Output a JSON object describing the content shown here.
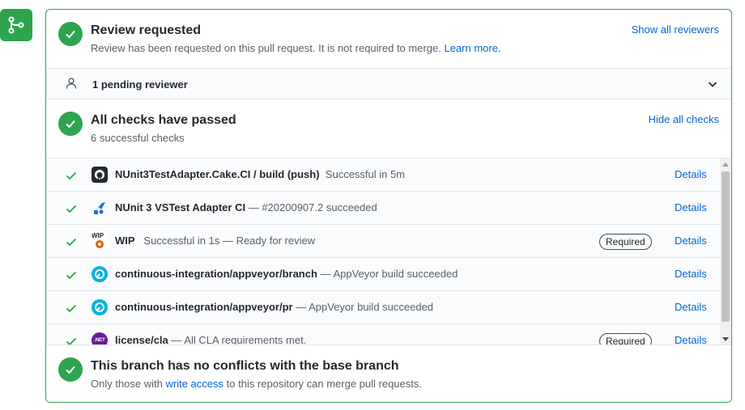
{
  "review": {
    "title": "Review requested",
    "subtitle": "Review has been requested on this pull request. It is not required to merge.",
    "learn_more": "Learn more.",
    "show_reviewers": "Show all reviewers"
  },
  "pending": {
    "label": "1 pending reviewer"
  },
  "checks": {
    "title": "All checks have passed",
    "subtitle": "6 successful checks",
    "hide_checks": "Hide all checks",
    "details_label": "Details",
    "required_label": "Required",
    "rows": [
      {
        "name": "NUnit3TestAdapter.Cake.CI / build (push)",
        "desc": "Successful in 5m",
        "required": false
      },
      {
        "name": "NUnit 3 VSTest Adapter CI",
        "desc": "— #20200907.2 succeeded",
        "required": false
      },
      {
        "name": "WIP",
        "desc": "Successful in 1s — Ready for review",
        "required": true
      },
      {
        "name": "continuous-integration/appveyor/branch",
        "desc": "— AppVeyor build succeeded",
        "required": false
      },
      {
        "name": "continuous-integration/appveyor/pr",
        "desc": "— AppVeyor build succeeded",
        "required": false
      },
      {
        "name": "license/cla",
        "desc": "— All CLA requirements met.",
        "required": true
      }
    ]
  },
  "branch": {
    "title": "This branch has no conflicts with the base branch",
    "subtitle_pre": "Only those with",
    "write_access": "write access",
    "subtitle_post": "to this repository can merge pull requests."
  },
  "icons": {
    "wip_text": "WIP",
    "net_text": ".NET"
  },
  "colors": {
    "success": "#2ea44f",
    "link": "#0366d6"
  }
}
